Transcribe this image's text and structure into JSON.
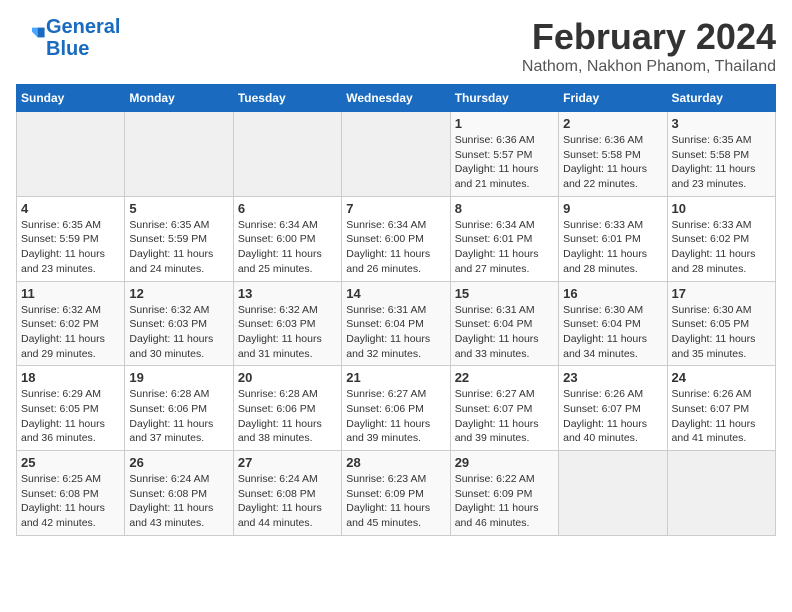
{
  "header": {
    "logo_line1": "General",
    "logo_line2": "Blue",
    "month_title": "February 2024",
    "location": "Nathom, Nakhon Phanom, Thailand"
  },
  "days_of_week": [
    "Sunday",
    "Monday",
    "Tuesday",
    "Wednesday",
    "Thursday",
    "Friday",
    "Saturday"
  ],
  "weeks": [
    [
      {
        "day": "",
        "info": ""
      },
      {
        "day": "",
        "info": ""
      },
      {
        "day": "",
        "info": ""
      },
      {
        "day": "",
        "info": ""
      },
      {
        "day": "1",
        "info": "Sunrise: 6:36 AM\nSunset: 5:57 PM\nDaylight: 11 hours and 21 minutes."
      },
      {
        "day": "2",
        "info": "Sunrise: 6:36 AM\nSunset: 5:58 PM\nDaylight: 11 hours and 22 minutes."
      },
      {
        "day": "3",
        "info": "Sunrise: 6:35 AM\nSunset: 5:58 PM\nDaylight: 11 hours and 23 minutes."
      }
    ],
    [
      {
        "day": "4",
        "info": "Sunrise: 6:35 AM\nSunset: 5:59 PM\nDaylight: 11 hours and 23 minutes."
      },
      {
        "day": "5",
        "info": "Sunrise: 6:35 AM\nSunset: 5:59 PM\nDaylight: 11 hours and 24 minutes."
      },
      {
        "day": "6",
        "info": "Sunrise: 6:34 AM\nSunset: 6:00 PM\nDaylight: 11 hours and 25 minutes."
      },
      {
        "day": "7",
        "info": "Sunrise: 6:34 AM\nSunset: 6:00 PM\nDaylight: 11 hours and 26 minutes."
      },
      {
        "day": "8",
        "info": "Sunrise: 6:34 AM\nSunset: 6:01 PM\nDaylight: 11 hours and 27 minutes."
      },
      {
        "day": "9",
        "info": "Sunrise: 6:33 AM\nSunset: 6:01 PM\nDaylight: 11 hours and 28 minutes."
      },
      {
        "day": "10",
        "info": "Sunrise: 6:33 AM\nSunset: 6:02 PM\nDaylight: 11 hours and 28 minutes."
      }
    ],
    [
      {
        "day": "11",
        "info": "Sunrise: 6:32 AM\nSunset: 6:02 PM\nDaylight: 11 hours and 29 minutes."
      },
      {
        "day": "12",
        "info": "Sunrise: 6:32 AM\nSunset: 6:03 PM\nDaylight: 11 hours and 30 minutes."
      },
      {
        "day": "13",
        "info": "Sunrise: 6:32 AM\nSunset: 6:03 PM\nDaylight: 11 hours and 31 minutes."
      },
      {
        "day": "14",
        "info": "Sunrise: 6:31 AM\nSunset: 6:04 PM\nDaylight: 11 hours and 32 minutes."
      },
      {
        "day": "15",
        "info": "Sunrise: 6:31 AM\nSunset: 6:04 PM\nDaylight: 11 hours and 33 minutes."
      },
      {
        "day": "16",
        "info": "Sunrise: 6:30 AM\nSunset: 6:04 PM\nDaylight: 11 hours and 34 minutes."
      },
      {
        "day": "17",
        "info": "Sunrise: 6:30 AM\nSunset: 6:05 PM\nDaylight: 11 hours and 35 minutes."
      }
    ],
    [
      {
        "day": "18",
        "info": "Sunrise: 6:29 AM\nSunset: 6:05 PM\nDaylight: 11 hours and 36 minutes."
      },
      {
        "day": "19",
        "info": "Sunrise: 6:28 AM\nSunset: 6:06 PM\nDaylight: 11 hours and 37 minutes."
      },
      {
        "day": "20",
        "info": "Sunrise: 6:28 AM\nSunset: 6:06 PM\nDaylight: 11 hours and 38 minutes."
      },
      {
        "day": "21",
        "info": "Sunrise: 6:27 AM\nSunset: 6:06 PM\nDaylight: 11 hours and 39 minutes."
      },
      {
        "day": "22",
        "info": "Sunrise: 6:27 AM\nSunset: 6:07 PM\nDaylight: 11 hours and 39 minutes."
      },
      {
        "day": "23",
        "info": "Sunrise: 6:26 AM\nSunset: 6:07 PM\nDaylight: 11 hours and 40 minutes."
      },
      {
        "day": "24",
        "info": "Sunrise: 6:26 AM\nSunset: 6:07 PM\nDaylight: 11 hours and 41 minutes."
      }
    ],
    [
      {
        "day": "25",
        "info": "Sunrise: 6:25 AM\nSunset: 6:08 PM\nDaylight: 11 hours and 42 minutes."
      },
      {
        "day": "26",
        "info": "Sunrise: 6:24 AM\nSunset: 6:08 PM\nDaylight: 11 hours and 43 minutes."
      },
      {
        "day": "27",
        "info": "Sunrise: 6:24 AM\nSunset: 6:08 PM\nDaylight: 11 hours and 44 minutes."
      },
      {
        "day": "28",
        "info": "Sunrise: 6:23 AM\nSunset: 6:09 PM\nDaylight: 11 hours and 45 minutes."
      },
      {
        "day": "29",
        "info": "Sunrise: 6:22 AM\nSunset: 6:09 PM\nDaylight: 11 hours and 46 minutes."
      },
      {
        "day": "",
        "info": ""
      },
      {
        "day": "",
        "info": ""
      }
    ]
  ]
}
